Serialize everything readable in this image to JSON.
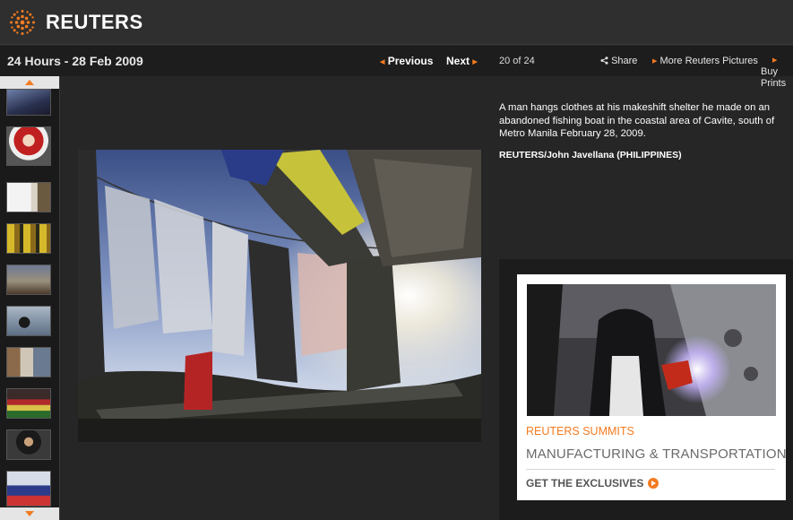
{
  "header": {
    "brand": "REUTERS",
    "logo_icon": "reuters-dots-logo",
    "logo_color": "#f47b20"
  },
  "nav": {
    "gallery_title": "24 Hours - 28 Feb 2009",
    "previous_label": "Previous",
    "next_label": "Next",
    "counter": "20 of 24",
    "share_label": "Share",
    "more_pictures_label": "More Reuters Pictures",
    "buy_prints_label": "Buy Prints",
    "accent_color": "#f47b20"
  },
  "photo": {
    "caption": "A man hangs clothes at his makeshift shelter he made on an abandoned fishing boat in the coastal area of Cavite, south of Metro Manila February 28, 2009.",
    "credit": "REUTERS/John Javellana (PHILIPPINES)"
  },
  "ad": {
    "kicker": "REUTERS SUMMITS",
    "headline": "MANUFACTURING & TRANSPORTATION",
    "cta": "GET THE EXCLUSIVES"
  }
}
